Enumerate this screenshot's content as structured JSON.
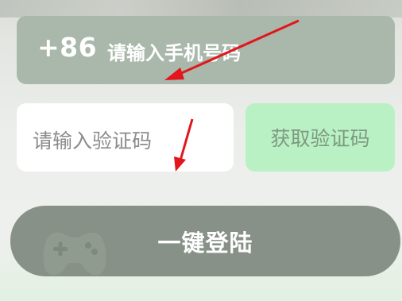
{
  "login": {
    "country_code": "+86",
    "phone_placeholder": "请输入手机号码",
    "code_placeholder": "请输入验证码",
    "get_code_label": "获取验证码",
    "submit_label": "一键登陆"
  },
  "colors": {
    "phone_box": "#a9b8ab",
    "get_code_button": "#baf1c4",
    "login_button": "#879187",
    "annotation_arrow": "#e2161c"
  },
  "icons": [
    "gamepad-icon",
    "red-arrow-annotation"
  ]
}
